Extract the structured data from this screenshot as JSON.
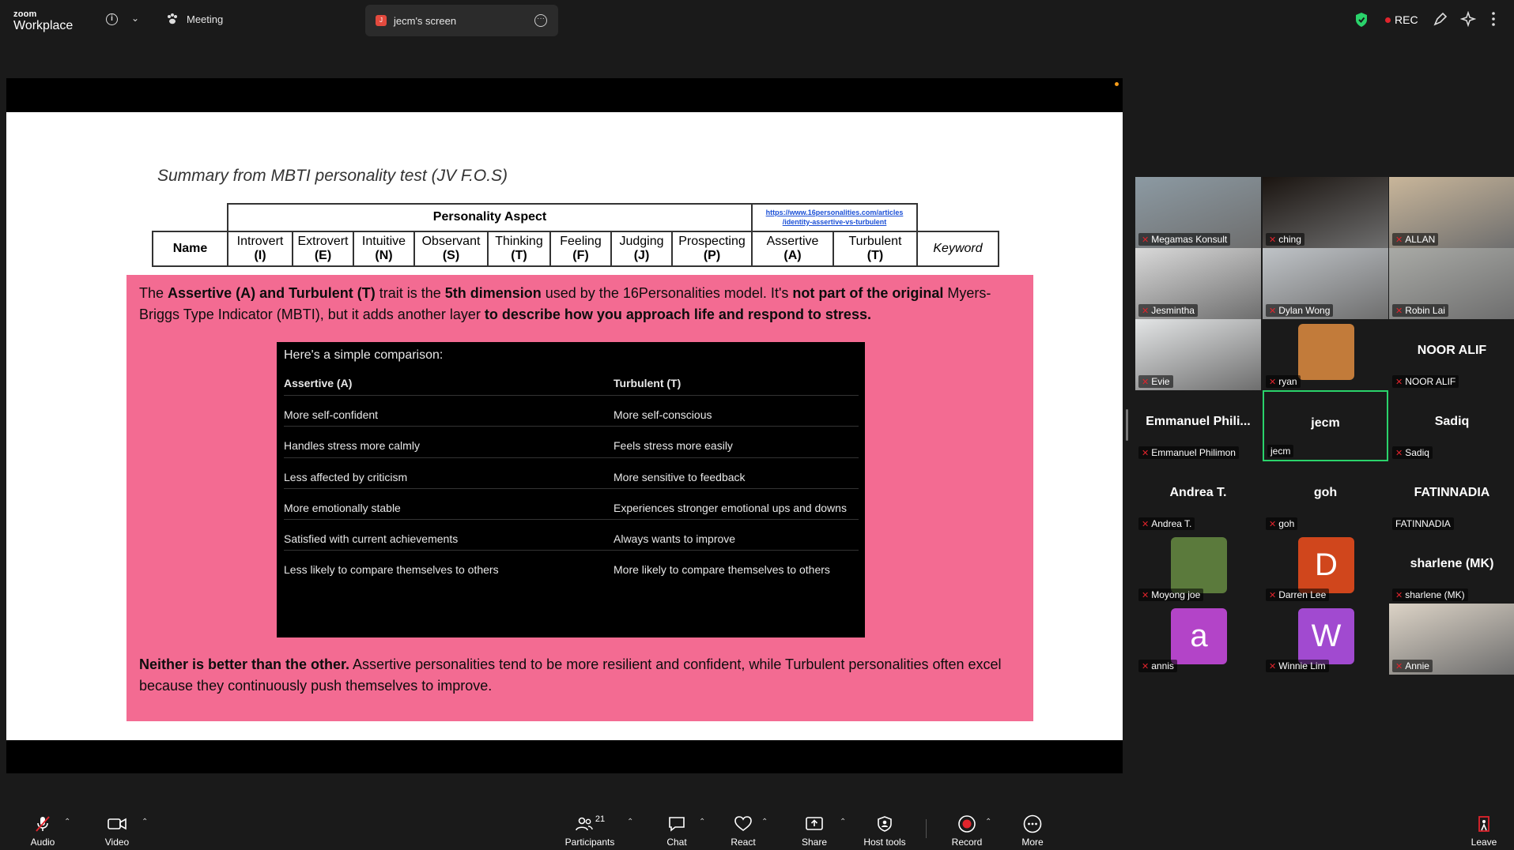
{
  "topbar": {
    "brand_small": "zoom",
    "brand_large": "Workplace",
    "meeting_label": "Meeting",
    "screen_tab_label": "jecm's screen",
    "screen_tab_initial": "J",
    "rec_label": "REC"
  },
  "slide": {
    "title": "Summary from MBTI personality test (JV F.O.S)",
    "table": {
      "group_header": "Personality Aspect",
      "link_text_1": "https://www.16personalities.com/articles",
      "link_text_2": "/identity-assertive-vs-turbulent",
      "name_header": "Name",
      "keyword_header": "Keyword",
      "traits": [
        {
          "label": "Introvert",
          "code": "(I)"
        },
        {
          "label": "Extrovert",
          "code": "(E)"
        },
        {
          "label": "Intuitive",
          "code": "(N)"
        },
        {
          "label": "Observant",
          "code": "(S)"
        },
        {
          "label": "Thinking",
          "code": "(T)"
        },
        {
          "label": "Feeling",
          "code": "(F)"
        },
        {
          "label": "Judging",
          "code": "(J)"
        },
        {
          "label": "Prospecting",
          "code": "(P)"
        },
        {
          "label": "Assertive",
          "code": "(A)"
        },
        {
          "label": "Turbulent",
          "code": "(T)"
        }
      ]
    },
    "overlay": {
      "p1_a": "The ",
      "p1_b": "Assertive (A) and Turbulent (T)",
      "p1_c": " trait is the ",
      "p1_d": "5th dimension",
      "p1_e": " used by the 16Personalities model. It's ",
      "p1_f": "not part of the original",
      "p1_g": " Myers-Briggs Type Indicator (MBTI), but it adds another layer ",
      "p1_h": "to describe how you approach life and respond to stress.",
      "comparison": {
        "intro": "Here's a simple comparison:",
        "col1_header": "Assertive (A)",
        "col2_header": "Turbulent (T)",
        "rows": [
          {
            "a": "More self-confident",
            "t": "More self-conscious"
          },
          {
            "a": "Handles stress more calmly",
            "t": "Feels stress more easily"
          },
          {
            "a": "Less affected by criticism",
            "t": "More sensitive to feedback"
          },
          {
            "a": "More emotionally stable",
            "t": "Experiences stronger emotional ups and downs"
          },
          {
            "a": "Satisfied with current achievements",
            "t": "Always wants to improve"
          },
          {
            "a": "Less likely to compare themselves to others",
            "t": "More likely to compare themselves to others"
          }
        ]
      },
      "p2_a": "Neither is better than the other.",
      "p2_b": " Assertive personalities tend to be more resilient and confident, while Turbulent personalities often excel because they continuously push themselves to improve."
    }
  },
  "participants": [
    {
      "name": "Megamas Konsult",
      "type": "video",
      "bg": "#8c9aa3"
    },
    {
      "name": "ching",
      "type": "video",
      "bg": "#1a1410"
    },
    {
      "name": "ALLAN",
      "type": "video",
      "bg": "#c9b69a"
    },
    {
      "name": "Jesmintha",
      "type": "video",
      "bg": "#d9d9d9"
    },
    {
      "name": "Dylan Wong",
      "type": "video",
      "bg": "#bfc3c7"
    },
    {
      "name": "Robin Lai",
      "type": "video",
      "bg": "#a9aaa6"
    },
    {
      "name": "Evie",
      "type": "video",
      "bg": "#e3e5e6"
    },
    {
      "name": "ryan",
      "type": "avatar-img",
      "bg": "#c27b3a"
    },
    {
      "name": "NOOR ALIF",
      "type": "name",
      "display": "NOOR ALIF"
    },
    {
      "name": "Emmanuel Philimon",
      "type": "name",
      "display": "Emmanuel  Phili..."
    },
    {
      "name": "jecm",
      "type": "name",
      "display": "jecm"
    },
    {
      "name": "Sadiq",
      "type": "name",
      "display": "Sadiq"
    },
    {
      "name": "Andrea T.",
      "type": "name",
      "display": "Andrea T."
    },
    {
      "name": "goh",
      "type": "name",
      "display": "goh"
    },
    {
      "name": "FATINNADIA",
      "type": "name",
      "display": "FATINNADIA"
    },
    {
      "name": "Moyong joe",
      "type": "avatar-img",
      "bg": "#5b7a3c"
    },
    {
      "name": "Darren Lee",
      "type": "letter",
      "letter": "D",
      "bg": "#d0461c"
    },
    {
      "name": "sharlene (MK)",
      "type": "name",
      "display": "sharlene (MK)"
    },
    {
      "name": "annis",
      "type": "letter",
      "letter": "a",
      "bg": "#b344c8"
    },
    {
      "name": "Winnie Lim",
      "type": "letter",
      "letter": "W",
      "bg": "#a14ad0"
    },
    {
      "name": "Annie",
      "type": "video",
      "bg": "#dcd3c6"
    }
  ],
  "toolbar": {
    "audio": "Audio",
    "video": "Video",
    "participants": "Participants",
    "participants_count": "21",
    "chat": "Chat",
    "react": "React",
    "share": "Share",
    "host_tools": "Host tools",
    "record": "Record",
    "more": "More",
    "leave": "Leave"
  },
  "colors": {
    "accent_green": "#2ad36b",
    "record_red": "#e0242c",
    "overlay_pink": "#f36b92"
  }
}
